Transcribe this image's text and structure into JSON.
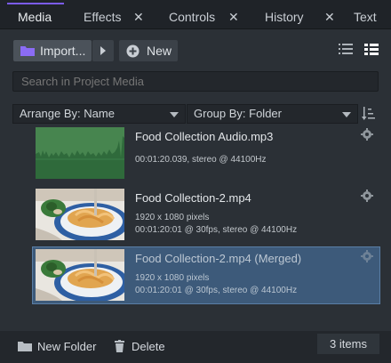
{
  "tabs": [
    {
      "label": "Media",
      "active": true
    },
    {
      "label": "Effects"
    },
    {
      "label": "Controls"
    },
    {
      "label": "History"
    },
    {
      "label": "Text"
    }
  ],
  "toolbar": {
    "import_label": "Import...",
    "new_label": "New"
  },
  "search": {
    "placeholder": "Search in Project Media"
  },
  "arrange": {
    "label": "Arrange By: Name"
  },
  "group": {
    "label": "Group By: Folder"
  },
  "media": [
    {
      "name": "Food Collection Audio.mp3",
      "line1": "",
      "line2": "00:01:20.039, stereo @ 44100Hz",
      "selected": false
    },
    {
      "name": "Food Collection-2.mp4",
      "line1": "1920 x 1080 pixels",
      "line2": "00:01:20:01 @ 30fps, stereo @ 44100Hz",
      "selected": false
    },
    {
      "name": "Food Collection-2.mp4 (Merged)",
      "line1": "1920 x 1080 pixels",
      "line2": "00:01:20:01 @ 30fps, stereo @ 44100Hz",
      "selected": true
    }
  ],
  "footer": {
    "new_folder_label": "New Folder",
    "delete_label": "Delete",
    "count_label": "3 items"
  },
  "colors": {
    "accent": "#7b5cf0",
    "selected": "#3d5a7a",
    "waveform": "#3e7a4c"
  }
}
